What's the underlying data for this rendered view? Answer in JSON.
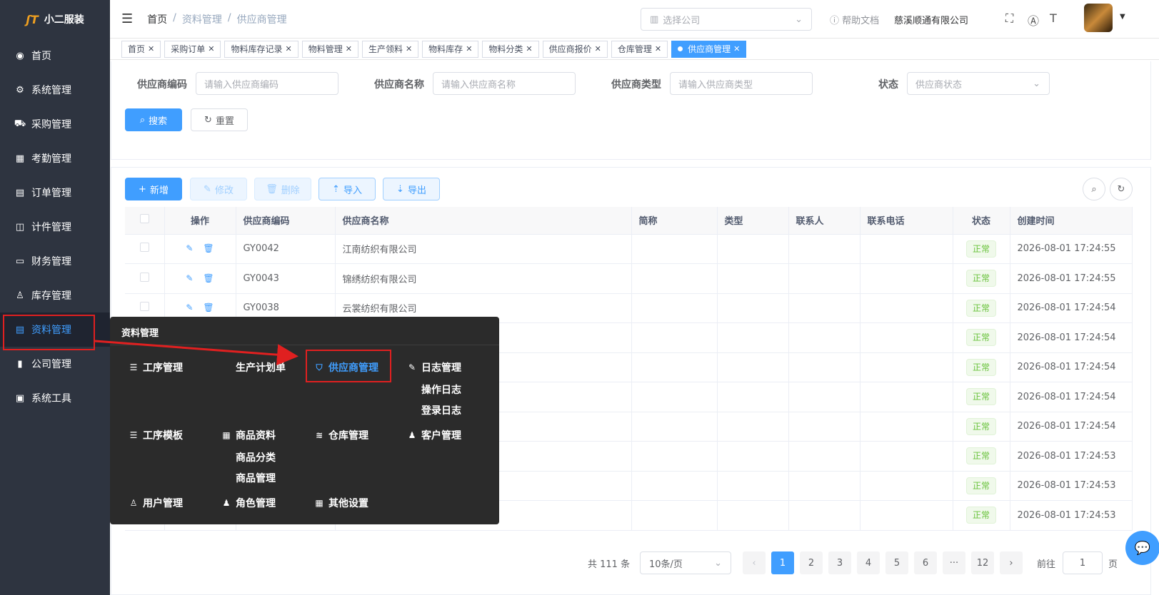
{
  "app": {
    "title": "小二服装"
  },
  "sidebar": {
    "items": [
      {
        "label": "首页",
        "icon": "dashboard-icon"
      },
      {
        "label": "系统管理",
        "icon": "gear-icon"
      },
      {
        "label": "采购管理",
        "icon": "cart-icon"
      },
      {
        "label": "考勤管理",
        "icon": "grid-icon"
      },
      {
        "label": "订单管理",
        "icon": "order-icon"
      },
      {
        "label": "计件管理",
        "icon": "book-icon"
      },
      {
        "label": "财务管理",
        "icon": "monitor-icon"
      },
      {
        "label": "库存管理",
        "icon": "user-icon"
      },
      {
        "label": "资料管理",
        "icon": "document-icon"
      },
      {
        "label": "公司管理",
        "icon": "bar-chart-icon"
      },
      {
        "label": "系统工具",
        "icon": "toolbox-icon"
      }
    ]
  },
  "header": {
    "breadcrumb": [
      "首页",
      "资料管理",
      "供应商管理"
    ],
    "company_placeholder": "选择公司",
    "help": "帮助文档",
    "company_name": "慈溪顺通有限公司"
  },
  "tags": [
    "首页",
    "采购订单",
    "物料库存记录",
    "物料管理",
    "生产领料",
    "物料库存",
    "物料分类",
    "供应商报价",
    "仓库管理",
    "供应商管理"
  ],
  "search": {
    "code_label": "供应商编码",
    "code_placeholder": "请输入供应商编码",
    "name_label": "供应商名称",
    "name_placeholder": "请输入供应商名称",
    "type_label": "供应商类型",
    "type_placeholder": "请输入供应商类型",
    "status_label": "状态",
    "status_placeholder": "供应商状态",
    "search_btn": "搜索",
    "reset_btn": "重置"
  },
  "toolbar": {
    "add": "新增",
    "edit": "修改",
    "delete": "删除",
    "import": "导入",
    "export": "导出"
  },
  "table": {
    "columns": [
      "操作",
      "供应商编码",
      "供应商名称",
      "简称",
      "类型",
      "联系人",
      "联系电话",
      "状态",
      "创建时间"
    ],
    "rows": [
      {
        "code": "GY0042",
        "name": "江南纺织有限公司",
        "status": "正常",
        "created": "2026-08-01 17:24:55"
      },
      {
        "code": "GY0043",
        "name": "锦绣纺织有限公司",
        "status": "正常",
        "created": "2026-08-01 17:24:55"
      },
      {
        "code": "GY0038",
        "name": "云裳纺织有限公司",
        "status": "正常",
        "created": "2026-08-01 17:24:54"
      },
      {
        "code": "",
        "name": "",
        "status": "正常",
        "created": "2026-08-01 17:24:54"
      },
      {
        "code": "",
        "name": "",
        "status": "正常",
        "created": "2026-08-01 17:24:54"
      },
      {
        "code": "",
        "name": "",
        "status": "正常",
        "created": "2026-08-01 17:24:54"
      },
      {
        "code": "",
        "name": "",
        "status": "正常",
        "created": "2026-08-01 17:24:54"
      },
      {
        "code": "",
        "name": "",
        "status": "正常",
        "created": "2026-08-01 17:24:53"
      },
      {
        "code": "",
        "name": "",
        "status": "正常",
        "created": "2026-08-01 17:24:53"
      },
      {
        "code": "",
        "name": "",
        "status": "正常",
        "created": "2026-08-01 17:24:53"
      }
    ]
  },
  "pagination": {
    "total": "共 111 条",
    "page_size": "10条/页",
    "pages": [
      "1",
      "2",
      "3",
      "4",
      "5",
      "6",
      "···",
      "12"
    ],
    "goto_prefix": "前往",
    "goto_value": "1",
    "goto_suffix": "页"
  },
  "flyout": {
    "title": "资料管理",
    "items": {
      "process": "工序管理",
      "plan": "生产计划单",
      "supplier": "供应商管理",
      "log": "日志管理",
      "op_log": "操作日志",
      "login_log": "登录日志",
      "template": "工序模板",
      "goods": "商品资料",
      "warehouse": "仓库管理",
      "customer": "客户管理",
      "goods_cat": "商品分类",
      "goods_mgmt": "商品管理",
      "user": "用户管理",
      "role": "角色管理",
      "other": "其他设置"
    }
  },
  "colors": {
    "primary": "#409eff",
    "sidebar": "#2e3440",
    "flyout": "#2b2b2b",
    "highlight": "#e02020",
    "success": "#67c23a"
  }
}
